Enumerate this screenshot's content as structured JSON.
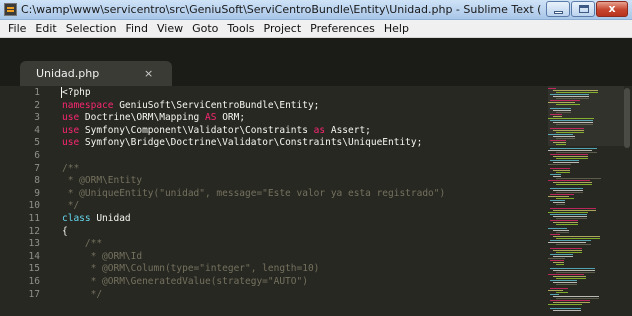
{
  "window": {
    "title": "C:\\wamp\\www\\servicentro\\src\\GeniuSoft\\ServiCentroBundle\\Entity\\Unidad.php - Sublime Text (UNREGISTERE...",
    "close_label": "x"
  },
  "menu": {
    "items": [
      "File",
      "Edit",
      "Selection",
      "Find",
      "View",
      "Goto",
      "Tools",
      "Project",
      "Preferences",
      "Help"
    ]
  },
  "tab": {
    "label": "Unidad.php",
    "close": "×"
  },
  "editor": {
    "line_numbers": [
      "1",
      "2",
      "3",
      "4",
      "5",
      "6",
      "7",
      "8",
      "9",
      "10",
      "11",
      "12",
      "13",
      "14",
      "15",
      "16",
      "17"
    ],
    "lines": [
      [
        {
          "t": "<?php",
          "c": "#f8f8f2"
        }
      ],
      [
        {
          "t": "namespace",
          "c": "#f92672"
        },
        {
          "t": " GeniuSoft\\ServiCentroBundle\\Entity;",
          "c": "#f8f8f2"
        }
      ],
      [
        {
          "t": "use",
          "c": "#f92672"
        },
        {
          "t": " Doctrine\\ORM\\Mapping ",
          "c": "#f8f8f2"
        },
        {
          "t": "AS",
          "c": "#f92672"
        },
        {
          "t": " ORM;",
          "c": "#f8f8f2"
        }
      ],
      [
        {
          "t": "use",
          "c": "#f92672"
        },
        {
          "t": " Symfony\\Component\\Validator\\Constraints ",
          "c": "#f8f8f2"
        },
        {
          "t": "as",
          "c": "#f92672"
        },
        {
          "t": " Assert;",
          "c": "#f8f8f2"
        }
      ],
      [
        {
          "t": "use",
          "c": "#f92672"
        },
        {
          "t": " Symfony\\Bridge\\Doctrine\\Validator\\Constraints\\UniqueEntity;",
          "c": "#f8f8f2"
        }
      ],
      [
        {
          "t": "",
          "c": "#f8f8f2"
        }
      ],
      [
        {
          "t": "/**",
          "c": "#75715e"
        }
      ],
      [
        {
          "t": " * @ORM\\Entity",
          "c": "#75715e"
        }
      ],
      [
        {
          "t": " * @UniqueEntity(\"unidad\", message=\"Este valor ya esta registrado\")",
          "c": "#75715e"
        }
      ],
      [
        {
          "t": " */",
          "c": "#75715e"
        }
      ],
      [
        {
          "t": "class",
          "c": "#66d9ef"
        },
        {
          "t": " Unidad",
          "c": "#f8f8f2"
        }
      ],
      [
        {
          "t": "{",
          "c": "#f8f8f2"
        }
      ],
      [
        {
          "t": "    /**",
          "c": "#75715e"
        }
      ],
      [
        {
          "t": "     * @ORM\\Id",
          "c": "#75715e"
        }
      ],
      [
        {
          "t": "     * @ORM\\Column(type=\"integer\", length=10)",
          "c": "#75715e"
        }
      ],
      [
        {
          "t": "     * @ORM\\GeneratedValue(strategy=\"AUTO\")",
          "c": "#75715e"
        }
      ],
      [
        {
          "t": "     */",
          "c": "#75715e"
        }
      ]
    ]
  },
  "colors": {
    "background": "#272822",
    "keyword": "#f92672",
    "storage": "#66d9ef",
    "comment": "#75715e",
    "text": "#f8f8f2",
    "line_number": "#8f908a"
  }
}
